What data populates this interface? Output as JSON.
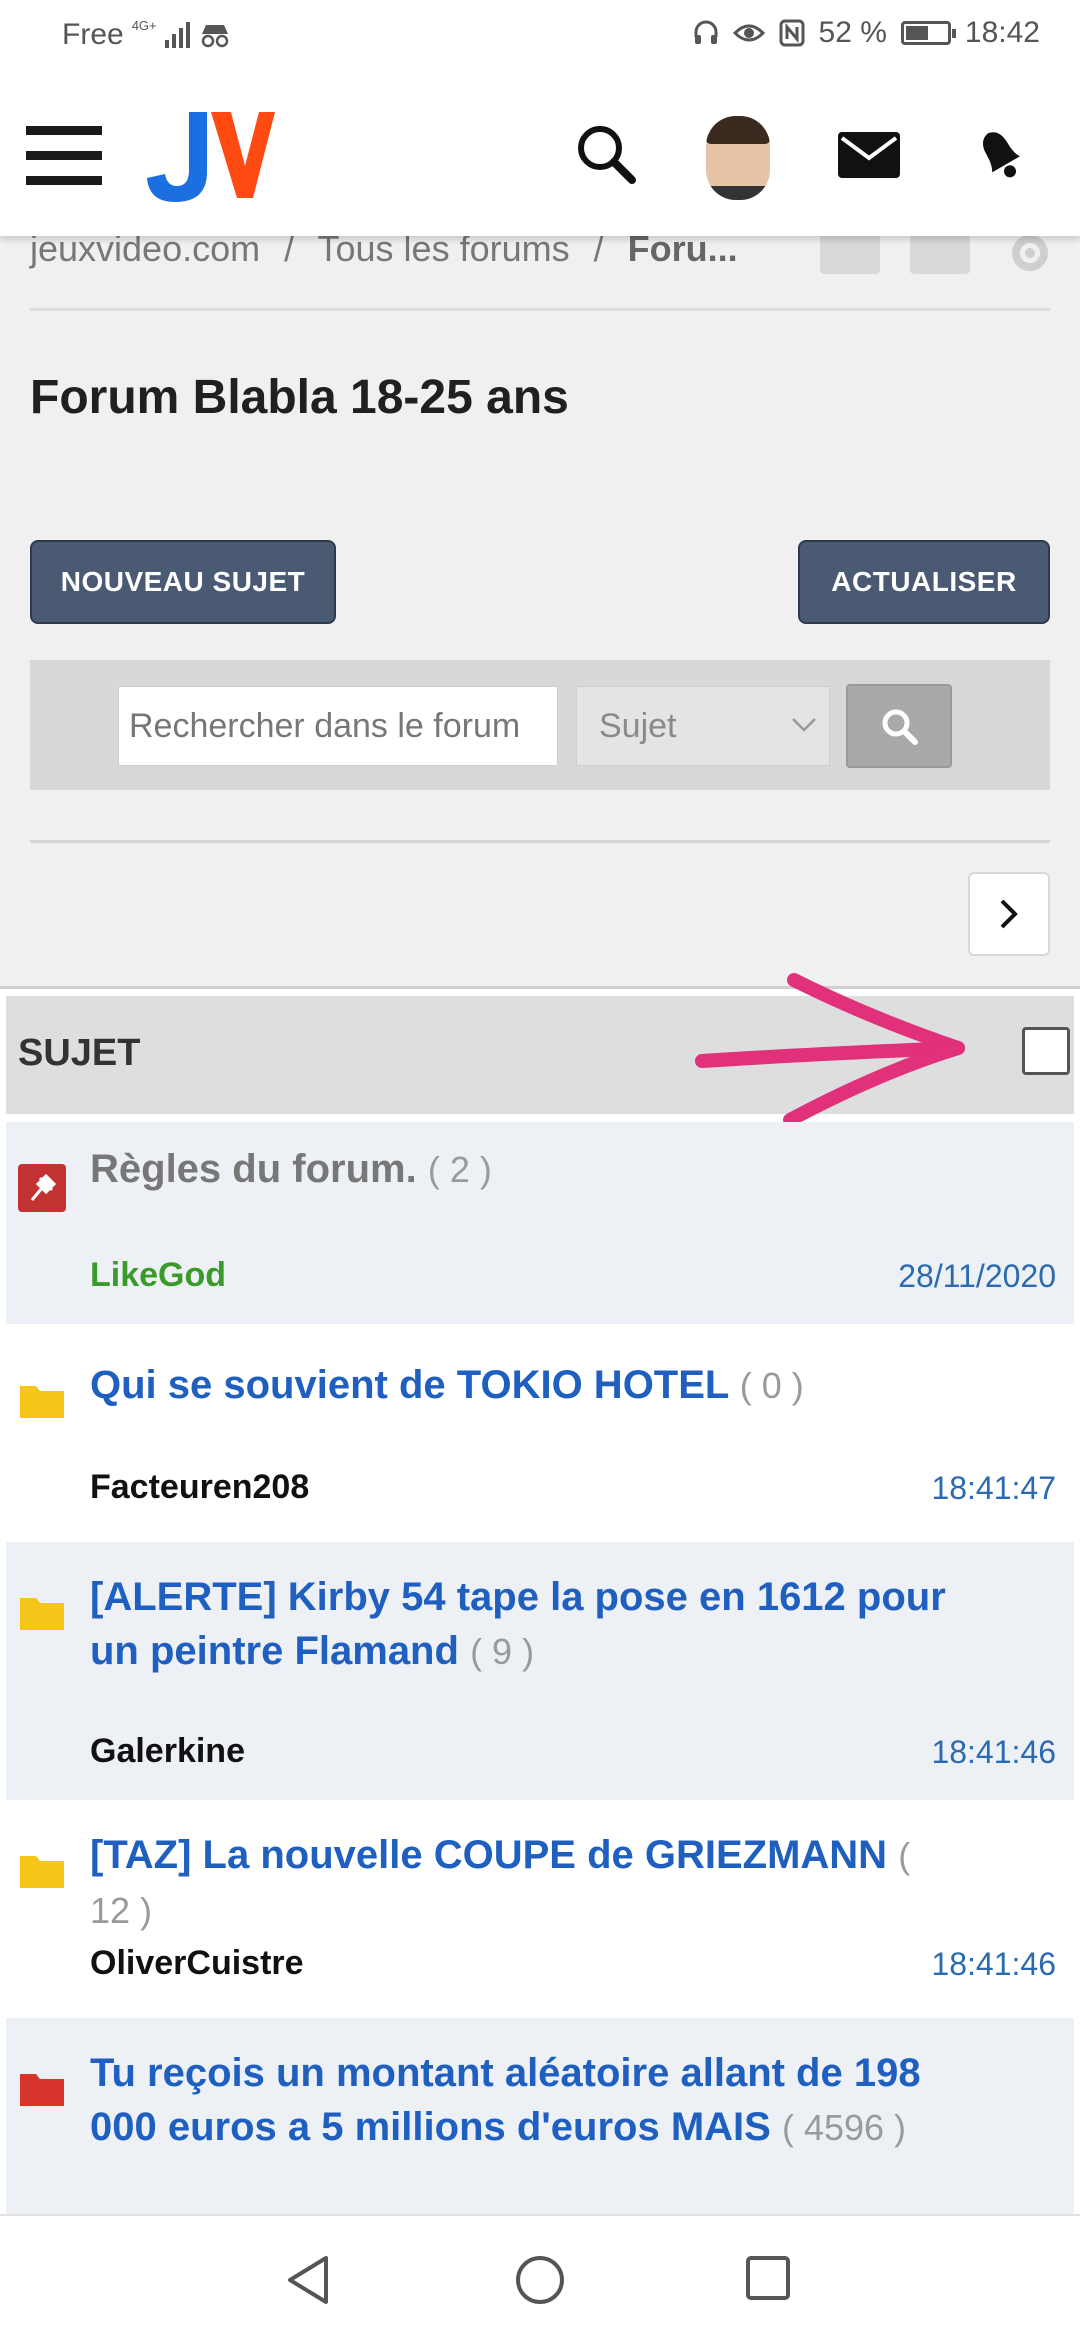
{
  "status_bar": {
    "carrier": "Free",
    "network": "4G+",
    "battery": "52 %",
    "time": "18:42"
  },
  "header": {
    "logo_alt": "JV",
    "icons": [
      "menu-icon",
      "search-icon",
      "avatar",
      "mail-icon",
      "bell-icon"
    ]
  },
  "breadcrumb": {
    "items": [
      "jeuxvideo.com",
      "Tous les forums",
      "Foru..."
    ],
    "separator": "/"
  },
  "forum": {
    "title": "Forum Blabla 18-25 ans",
    "new_topic_label": "NOUVEAU SUJET",
    "refresh_label": "ACTUALISER"
  },
  "search": {
    "placeholder": "Rechercher dans le forum",
    "filter_value": "Sujet"
  },
  "table": {
    "header_label": "SUJET"
  },
  "topics": [
    {
      "title": "Règles du forum.",
      "count": "( 2 )",
      "author": "LikeGod",
      "date": "28/11/2020",
      "type": "pinned"
    },
    {
      "title": "Qui se souvient de TOKIO HOTEL",
      "count": "( 0 )",
      "author": "Facteuren208",
      "date": "18:41:47",
      "type": "normal"
    },
    {
      "title": "[ALERTE] Kirby 54 tape la pose en 1612 pour un peintre Flamand",
      "count": "( 9 )",
      "author": "Galerkine",
      "date": "18:41:46",
      "type": "normal"
    },
    {
      "title": "[TAZ] La nouvelle COUPE de GRIEZMANN",
      "count": "( 12 )",
      "author": "OliverCuistre",
      "date": "18:41:46",
      "type": "normal"
    },
    {
      "title": "Tu reçois un montant aléatoire allant de 198 000 euros a 5 millions d'euros MAIS",
      "count": "( 4596 )",
      "author": "",
      "date": "",
      "type": "hot"
    }
  ],
  "colors": {
    "button_bg": "#4a5a73",
    "topic_link": "#1f5fbf",
    "author_admin": "#3a9a2a",
    "annotation_arrow": "#e0317a",
    "folder_yellow": "#f5c518",
    "folder_red": "#d9342b"
  }
}
